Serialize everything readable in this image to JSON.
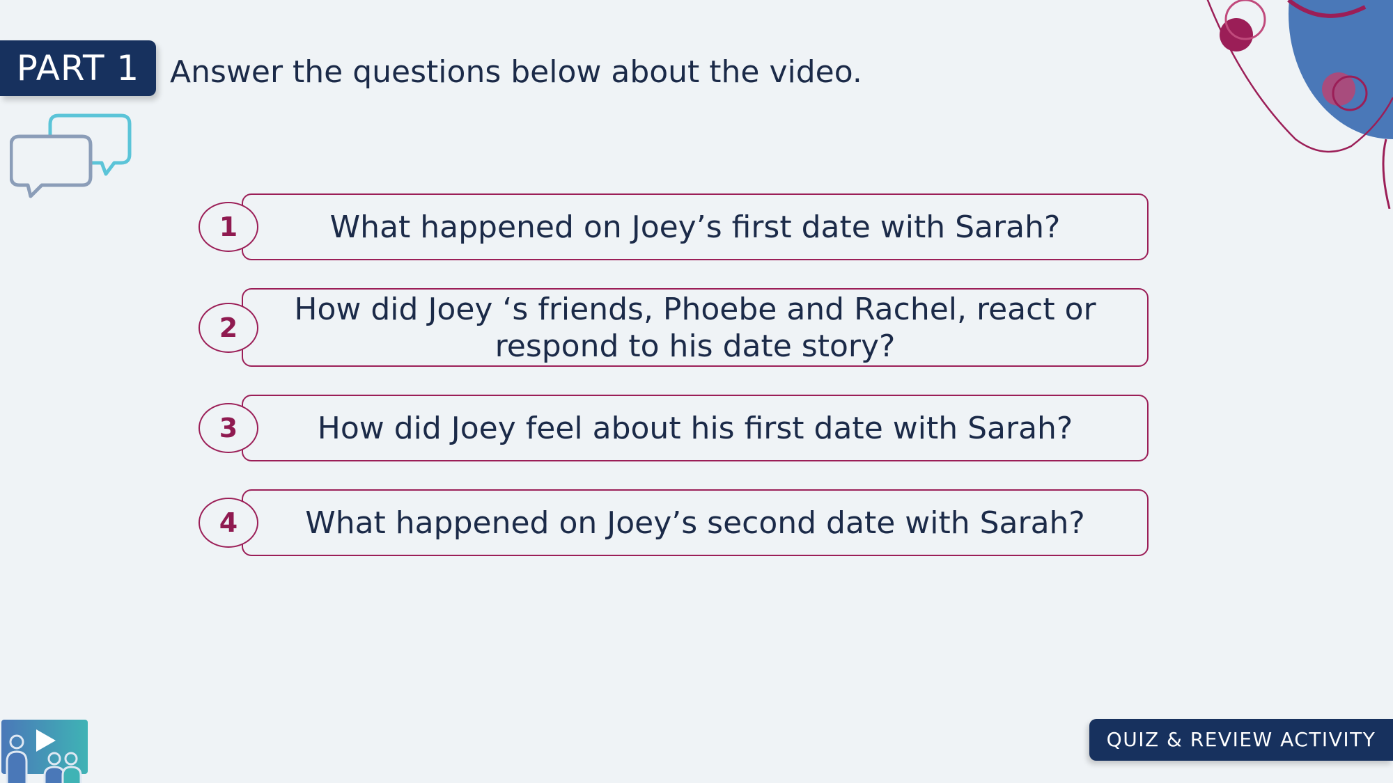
{
  "header": {
    "part_label": "PART 1",
    "instruction": "Answer the questions below about the video."
  },
  "icons": {
    "chat": "chat-bubbles-icon",
    "logo": "video-class-logo-icon",
    "decoration": "abstract-circles-decoration"
  },
  "questions": [
    {
      "number": "1",
      "text": "What happened on Joey’s first date with Sarah?"
    },
    {
      "number": "2",
      "text": "How did Joey ‘s friends, Phoebe and Rachel, react or respond to his date story?"
    },
    {
      "number": "3",
      "text": "How did Joey feel about his first date with Sarah?"
    },
    {
      "number": "4",
      "text": "What happened on Joey’s second date with Sarah?"
    }
  ],
  "footer": {
    "activity_label": "QUIZ & REVIEW ACTIVITY"
  },
  "colors": {
    "background": "#eff3f6",
    "navy": "#17315e",
    "accent": "#9b1e57",
    "text": "#1b2a48",
    "deco_blue": "#4a78b8"
  }
}
